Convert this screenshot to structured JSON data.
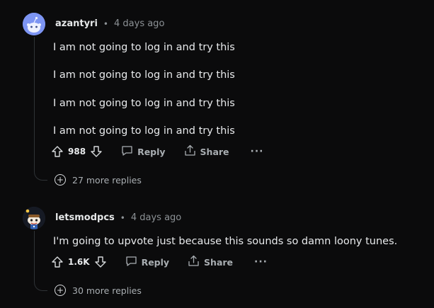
{
  "comments": [
    {
      "username": "azantyri",
      "separator": "•",
      "time": "4 days ago",
      "lines": [
        "I am not going to log in and try this",
        "I am not going to log in and try this",
        "I am not going to log in and try this",
        "I am not going to log in and try this"
      ],
      "score": "988",
      "reply_label": "Reply",
      "share_label": "Share",
      "more_label": "···",
      "more_replies": "27 more replies",
      "avatar_color": "#6f8ff0"
    },
    {
      "username": "letsmodpcs",
      "separator": "•",
      "time": "4 days ago",
      "lines": [
        "I'm going to upvote just because this sounds so damn loony tunes."
      ],
      "score": "1.6K",
      "reply_label": "Reply",
      "share_label": "Share",
      "more_label": "···",
      "more_replies": "30 more replies",
      "avatar_color": "#1f2a44"
    }
  ],
  "icons": {
    "upvote": "arrow-up-outline",
    "downvote": "arrow-down-outline",
    "reply": "speech-bubble",
    "share": "share-tray",
    "more_replies": "plus-circle"
  }
}
